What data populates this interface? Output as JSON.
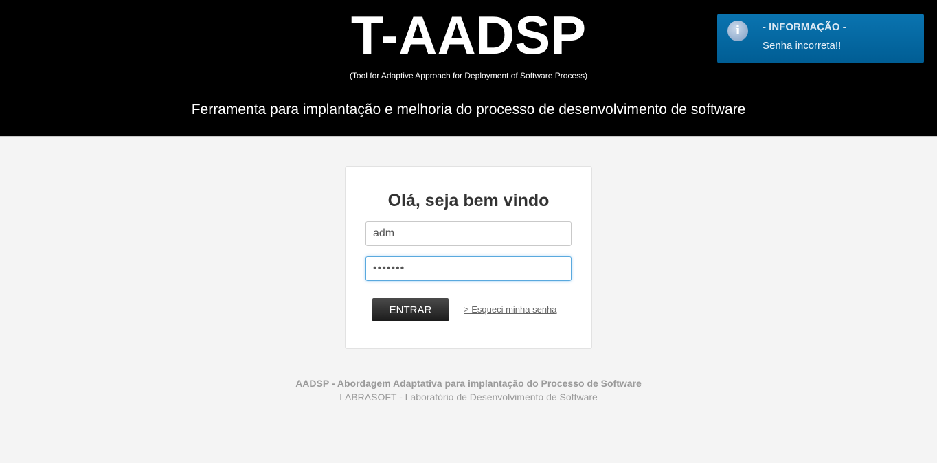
{
  "header": {
    "title": "T-AADSP",
    "subtitle": "(Tool for Adaptive Approach for Deployment of Software Process)",
    "tagline": "Ferramenta para implantação e melhoria do processo de desenvolvimento de software",
    "background_color": "#000000"
  },
  "notification": {
    "icon": "info-icon",
    "icon_glyph": "i",
    "title": "- INFORMAÇÃO -",
    "message": "Senha incorreta!!",
    "background_color": "#0a6aa4"
  },
  "login": {
    "heading": "Olá, seja bem vindo",
    "username_value": "adm",
    "password_value": "•••••••",
    "submit_label": "ENTRAR",
    "forgot_link": "> Esqueci minha senha"
  },
  "footer": {
    "line1": "AADSP - Abordagem Adaptativa para implantação do Processo de Software",
    "line2": "LABRASOFT - Laboratório de Desenvolvimento de Software"
  }
}
